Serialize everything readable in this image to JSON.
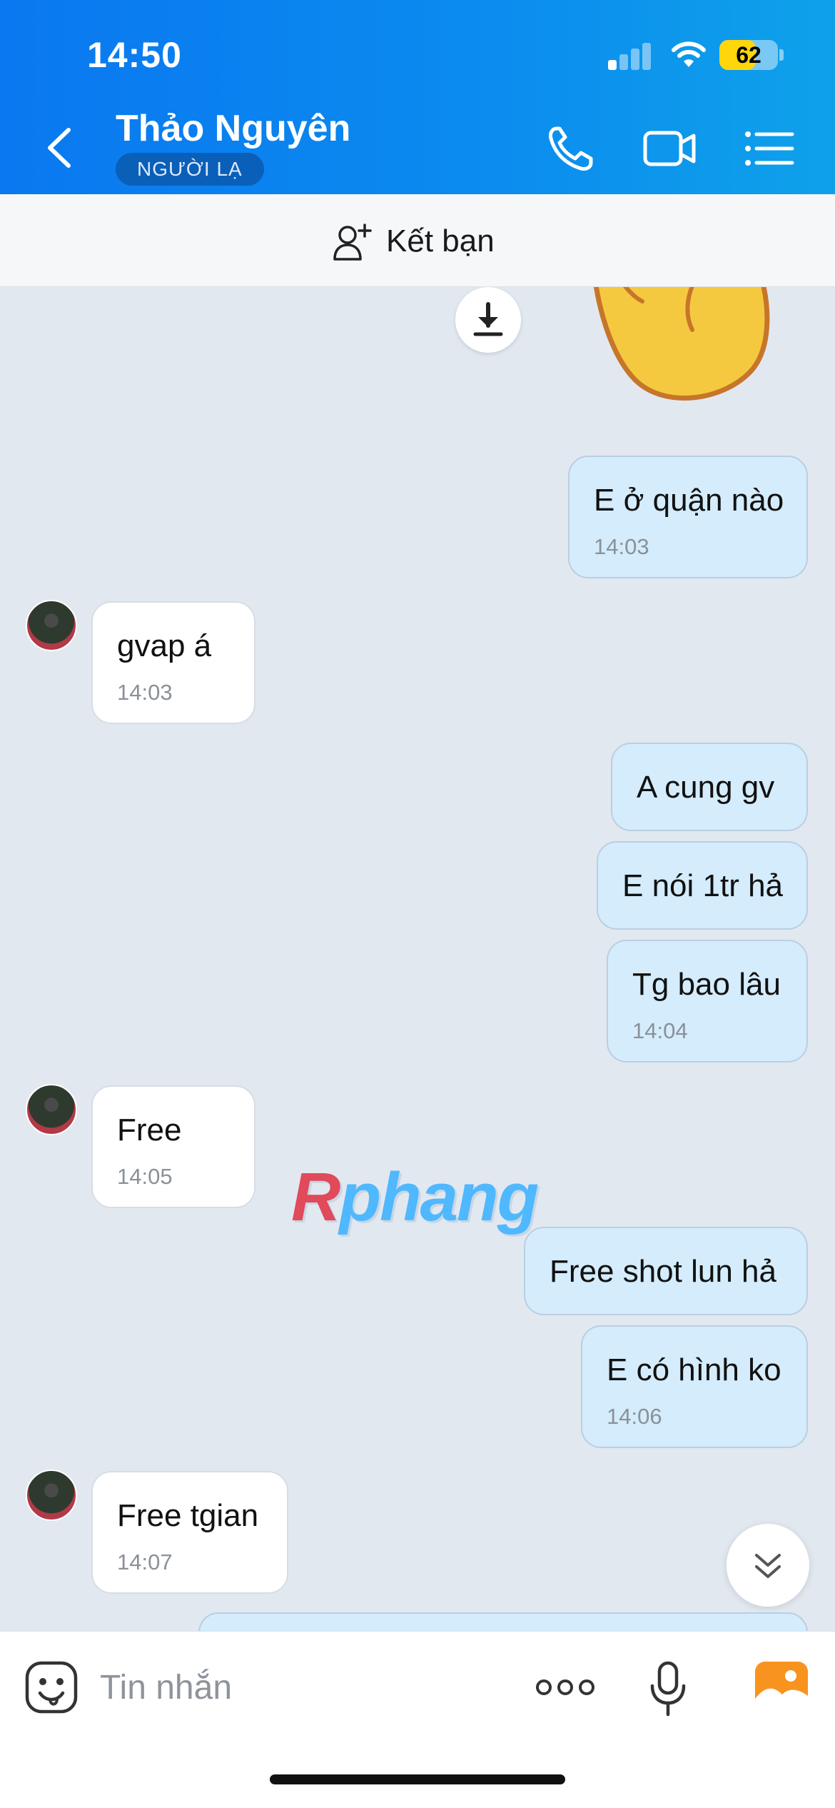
{
  "status_bar": {
    "time": "14:50",
    "battery": "62",
    "signal_bars_active": 1
  },
  "header": {
    "contact_name": "Thảo Nguyên",
    "badge": "NGƯỜI LẠ",
    "icons": [
      "back-icon",
      "phone-icon",
      "video-call-icon",
      "menu-list-icon"
    ]
  },
  "add_friend": {
    "label": "Kết bạn"
  },
  "messages": [
    {
      "dir": "out",
      "text": "E ở quận nào",
      "time": "14:03"
    },
    {
      "dir": "in",
      "text": "gvap á",
      "time": "14:03"
    },
    {
      "dir": "out",
      "text": "A cung gv",
      "time": ""
    },
    {
      "dir": "out",
      "text": "E nói 1tr hả",
      "time": ""
    },
    {
      "dir": "out",
      "text": "Tg bao lâu",
      "time": "14:04"
    },
    {
      "dir": "in",
      "text": "Free",
      "time": "14:05"
    },
    {
      "dir": "out",
      "text": "Free shot lun hả",
      "time": ""
    },
    {
      "dir": "out",
      "text": "E có hình ko",
      "time": "14:06"
    },
    {
      "dir": "in",
      "text": "Free tgian",
      "time": "14:07"
    }
  ],
  "watermark": {
    "r": "R",
    "rest": "phang"
  },
  "composer": {
    "placeholder": "Tin nhắn"
  },
  "colors": {
    "header": "#0b8aef",
    "outgoing_bubble": "#d4ecfb",
    "incoming_bubble": "#ffffff",
    "badge": "#0a5fb8",
    "photo_icon": "#f7931e"
  }
}
